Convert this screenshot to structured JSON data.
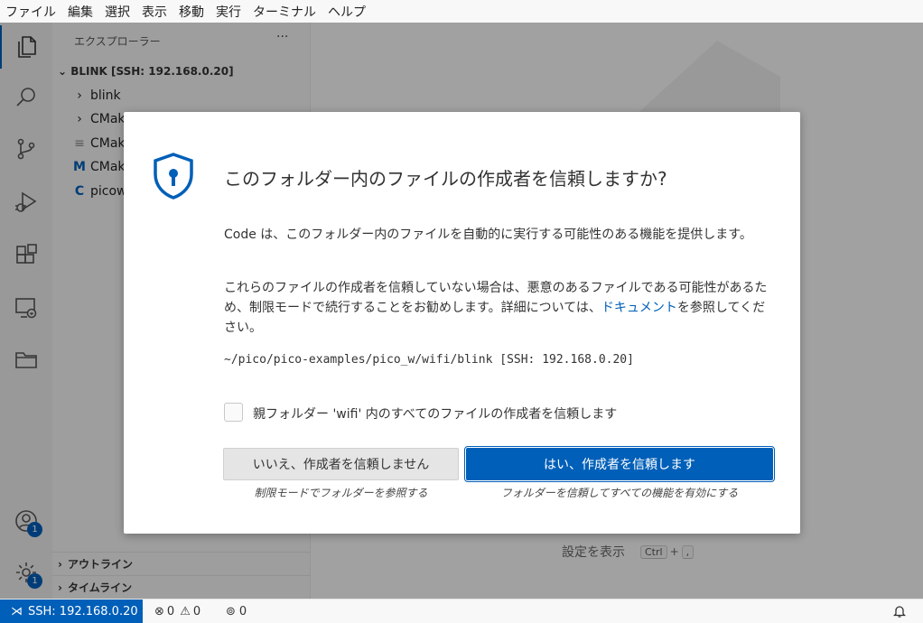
{
  "menubar": [
    "ファイル",
    "編集",
    "選択",
    "表示",
    "移動",
    "実行",
    "ターミナル",
    "ヘルプ"
  ],
  "activity_badges": {
    "accounts": "1",
    "manage": "1"
  },
  "explorer": {
    "title": "エクスプローラー",
    "more": "···",
    "folder": "BLINK [SSH: 192.168.0.20]",
    "items": [
      {
        "label": "blink",
        "icon": "chevron-right-icon"
      },
      {
        "label": "CMak",
        "icon": "chevron-right-icon"
      },
      {
        "label": "CMak",
        "icon": "text-file-icon"
      },
      {
        "label": "CMak",
        "icon": "M"
      },
      {
        "label": "picow",
        "icon": "C"
      }
    ],
    "outline": "アウトライン",
    "timeline": "タイムライン"
  },
  "editor_hint": {
    "label": "設定を表示",
    "key1": "Ctrl",
    "plus": "+",
    "key2": ","
  },
  "dialog": {
    "title": "このフォルダー内のファイルの作成者を信頼しますか?",
    "p1": "Code は、このフォルダー内のファイルを自動的に実行する可能性のある機能を提供します。",
    "p2_before": "これらのファイルの作成者を信頼していない場合は、悪意のあるファイルである可能性があるため、制限モードで続行することをお勧めします。詳細については、",
    "p2_link": "ドキュメント",
    "p2_after": "を参照してください。",
    "path": "~/pico/pico-examples/pico_w/wifi/blink [SSH: 192.168.0.20]",
    "checkbox_label": "親フォルダー 'wifi' 内のすべてのファイルの作成者を信頼します",
    "no_button": "いいえ、作成者を信頼しません",
    "no_sub": "制限モードでフォルダーを参照する",
    "yes_button": "はい、作成者を信頼します",
    "yes_sub": "フォルダーを信頼してすべての機能を有効にする"
  },
  "status": {
    "remote": "SSH: 192.168.0.20",
    "errors": "0",
    "warnings": "0",
    "ports": "0"
  },
  "colors": {
    "accent": "#005fb8",
    "overlay": "rgba(0,0,0,0.35)"
  }
}
